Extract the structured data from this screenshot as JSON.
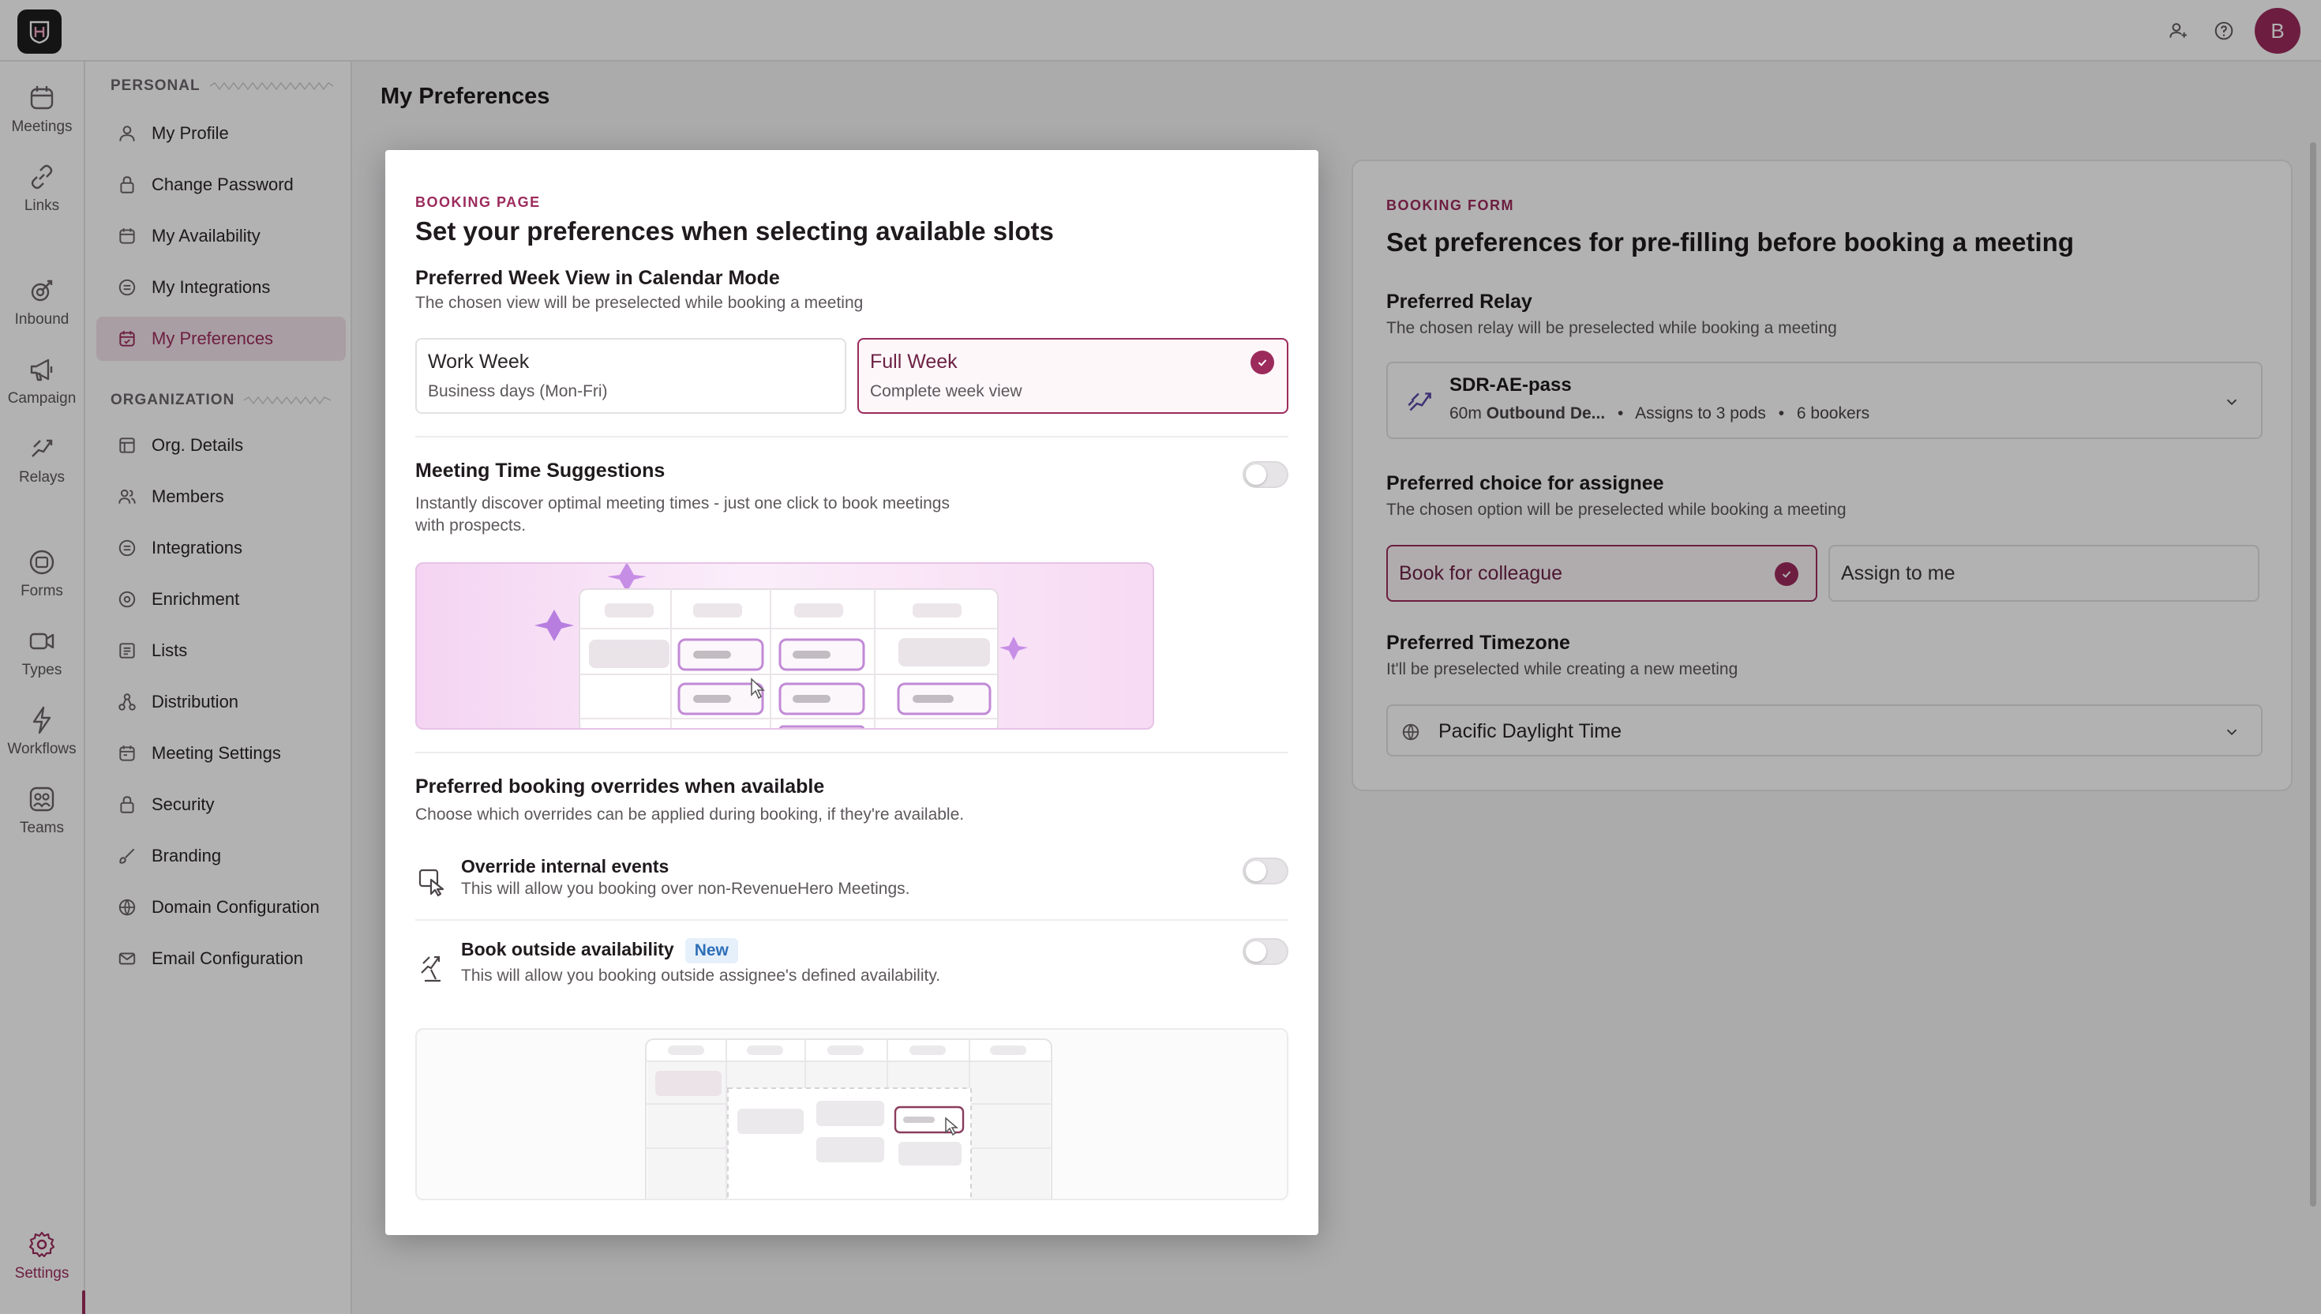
{
  "app": {
    "avatar_initial": "B",
    "accent": "#9c2b5c"
  },
  "rail": [
    {
      "label": "Meetings",
      "icon": "calendar-icon"
    },
    {
      "label": "Links",
      "icon": "link-icon"
    },
    {
      "label": "Inbound",
      "icon": "inbound-icon"
    },
    {
      "label": "Campaign",
      "icon": "megaphone-icon"
    },
    {
      "label": "Relays",
      "icon": "relay-icon"
    },
    {
      "label": "Forms",
      "icon": "forms-icon"
    },
    {
      "label": "Types",
      "icon": "video-icon"
    },
    {
      "label": "Workflows",
      "icon": "lightning-icon"
    },
    {
      "label": "Teams",
      "icon": "teams-icon"
    },
    {
      "label": "Settings",
      "icon": "gear-icon"
    }
  ],
  "sidebar": {
    "personal_label": "PERSONAL",
    "organization_label": "ORGANIZATION",
    "personal_items": [
      {
        "label": "My Profile",
        "icon": "user-icon"
      },
      {
        "label": "Change Password",
        "icon": "lock-icon"
      },
      {
        "label": "My Availability",
        "icon": "calendar-icon"
      },
      {
        "label": "My Integrations",
        "icon": "integrations-icon"
      },
      {
        "label": "My Preferences",
        "icon": "calendar-check-icon",
        "active": true
      }
    ],
    "org_items": [
      {
        "label": "Org. Details",
        "icon": "building-icon"
      },
      {
        "label": "Members",
        "icon": "members-icon"
      },
      {
        "label": "Integrations",
        "icon": "integrations-icon"
      },
      {
        "label": "Enrichment",
        "icon": "enrichment-icon"
      },
      {
        "label": "Lists",
        "icon": "list-icon"
      },
      {
        "label": "Distribution",
        "icon": "distribution-icon"
      },
      {
        "label": "Meeting Settings",
        "icon": "meeting-settings-icon"
      },
      {
        "label": "Security",
        "icon": "lock-icon"
      },
      {
        "label": "Branding",
        "icon": "brush-icon"
      },
      {
        "label": "Domain Configuration",
        "icon": "globe-icon"
      },
      {
        "label": "Email Configuration",
        "icon": "mail-icon"
      }
    ]
  },
  "main": {
    "title": "My Preferences"
  },
  "booking_form": {
    "eyebrow": "BOOKING FORM",
    "title": "Set preferences for pre-filling before booking a meeting",
    "relay_heading": "Preferred Relay",
    "relay_desc": "The chosen relay will be preselected while booking a meeting",
    "relay_name": "SDR-AE-pass",
    "relay_duration": "60m",
    "relay_type": "Outbound De...",
    "relay_pods": "Assigns to 3 pods",
    "relay_bookers": "6 bookers",
    "assignee_heading": "Preferred choice for assignee",
    "assignee_desc": "The chosen option will be preselected while booking a meeting",
    "assignee_option_1": "Book for colleague",
    "assignee_option_2": "Assign to me",
    "timezone_heading": "Preferred Timezone",
    "timezone_desc": "It'll be preselected while creating a new meeting",
    "timezone_value": "Pacific Daylight Time"
  },
  "booking_page": {
    "eyebrow": "BOOKING PAGE",
    "title": "Set your preferences when selecting available slots",
    "week_heading": "Preferred Week View in Calendar Mode",
    "week_desc": "The chosen view will be preselected while booking a meeting",
    "work_week_title": "Work Week",
    "work_week_desc": "Business days (Mon-Fri)",
    "full_week_title": "Full Week",
    "full_week_desc": "Complete week view",
    "suggestions_heading": "Meeting Time Suggestions",
    "suggestions_desc_line1": "Instantly discover optimal meeting times - just one click to book meetings",
    "suggestions_desc_line2": "with prospects.",
    "suggestions_enabled": false,
    "overrides_heading": "Preferred booking overrides when available",
    "overrides_desc": "Choose which overrides can be applied during booking, if they're available.",
    "override_internal_title": "Override internal events",
    "override_internal_desc": "This will allow you booking over non-RevenueHero Meetings.",
    "override_internal_enabled": false,
    "outside_title": "Book outside availability",
    "outside_badge": "New",
    "outside_desc": "This will allow you booking outside assignee's defined availability.",
    "outside_enabled": false
  }
}
